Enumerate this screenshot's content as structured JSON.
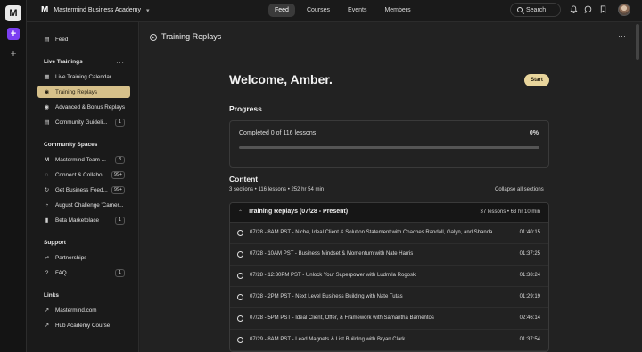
{
  "rail": {
    "logo": "M",
    "new_symbol": "+",
    "add_symbol": "+"
  },
  "topbar": {
    "brand_icon": "M",
    "community_name": "Mastermind Business Academy",
    "brand_caret": "▾",
    "nav": [
      {
        "label": "Feed",
        "active": true
      },
      {
        "label": "Courses",
        "active": false
      },
      {
        "label": "Events",
        "active": false
      },
      {
        "label": "Members",
        "active": false
      }
    ],
    "search_label": "Search"
  },
  "sidebar": {
    "feed": {
      "icon": "feed-icon",
      "glyph": "▤",
      "label": "Feed"
    },
    "live_trainings_heading": "Live Trainings",
    "live_trainings_menu": "···",
    "live_trainings": [
      {
        "icon": "calendar-icon",
        "glyph": "▦",
        "label": "Live Training Calendar",
        "badge": ""
      },
      {
        "icon": "replay-icon",
        "glyph": "◉",
        "label": "Training Replays",
        "badge": "",
        "active": true
      },
      {
        "icon": "replay-icon",
        "glyph": "◉",
        "label": "Advanced & Bonus Replays",
        "badge": ""
      },
      {
        "icon": "document-icon",
        "glyph": "▤",
        "label": "Community Guideli...",
        "badge": "1"
      }
    ],
    "community_heading": "Community Spaces",
    "community": [
      {
        "icon": "brand-icon",
        "glyph": "M",
        "label": "Mastermind Team ...",
        "badge": "3"
      },
      {
        "icon": "chat-icon",
        "glyph": "◌",
        "label": "Connect & Collabo...",
        "badge": "99+"
      },
      {
        "icon": "loop-icon",
        "glyph": "↻",
        "label": "Get Business Feed...",
        "badge": "99+"
      },
      {
        "icon": "clock-icon",
        "glyph": "◔",
        "label": "August Challenge 'Camer...",
        "badge": ""
      },
      {
        "icon": "megaphone-icon",
        "glyph": "▮",
        "label": "Beta Marketplace",
        "badge": "1"
      }
    ],
    "support_heading": "Support",
    "support": [
      {
        "icon": "partnership-icon",
        "glyph": "⇌",
        "label": "Partnerships",
        "badge": ""
      },
      {
        "icon": "question-icon",
        "glyph": "?",
        "label": "FAQ",
        "badge": "1"
      }
    ],
    "links_heading": "Links",
    "links": [
      {
        "icon": "external-link-icon",
        "glyph": "↗",
        "label": "Mastermind.com"
      },
      {
        "icon": "external-link-icon",
        "glyph": "↗",
        "label": "Hub Academy Course"
      }
    ]
  },
  "main": {
    "page_title": "Training Replays",
    "page_menu": "···",
    "welcome": "Welcome, Amber.",
    "start_label": "Start",
    "progress_heading": "Progress",
    "progress_text": "Completed 0 of 116 lessons",
    "progress_percent": "0%",
    "progress_value": 0,
    "content_heading": "Content",
    "content_meta": "3 sections • 116 lessons • 252 hr 54 min",
    "collapse_label": "Collapse all sections",
    "section": {
      "caret": "⌃",
      "title": "Training Replays (07/28 - Present)",
      "meta": "37 lessons • 63 hr 10 min",
      "lessons": [
        {
          "title": "07/28 - 8AM PST - Niche, Ideal Client & Solution Statement with Coaches Randall, Galyn, and Shanda",
          "duration": "01:40:15"
        },
        {
          "title": "07/28 - 10AM PST - Business Mindset & Momentum with Nate Harris",
          "duration": "01:37:25"
        },
        {
          "title": "07/28 - 12:30PM PST - Unlock Your Superpower with Ludmila Rogoski",
          "duration": "01:38:24"
        },
        {
          "title": "07/28 - 2PM PST - Next Level Business Building with Nate Tutas",
          "duration": "01:29:19"
        },
        {
          "title": "07/28 - 5PM PST - Ideal Client, Offer, & Framework with Samantha Barrientos",
          "duration": "02:46:14"
        },
        {
          "title": "07/29 - 8AM PST - Lead Magnets & List Building with Bryan Clark",
          "duration": "01:37:54"
        }
      ]
    }
  }
}
